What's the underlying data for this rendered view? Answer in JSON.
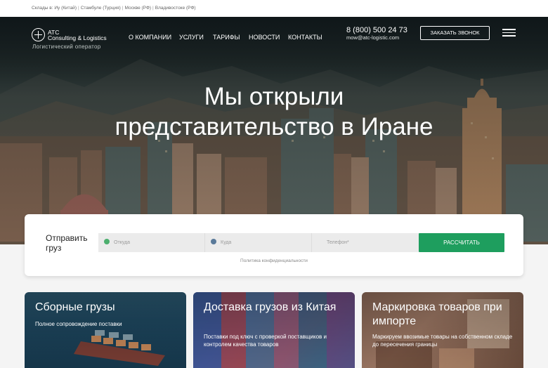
{
  "topbar": {
    "items": [
      "Склады в: Иу (Китай)",
      "Стамбуле (Турция)",
      "Москве (РФ)",
      "Владивостоке (РФ)"
    ],
    "separator": "|"
  },
  "logo": {
    "line1": "ATC",
    "line2": "Consulting & Logistics",
    "subtitle": "Логистический оператор"
  },
  "nav": {
    "items": [
      "О КОМПАНИИ",
      "УСЛУГИ",
      "ТАРИФЫ",
      "НОВОСТИ",
      "КОНТАКТЫ"
    ]
  },
  "contacts": {
    "phone": "8 (800) 500 24 73",
    "email": "mow@atc-logistic.com"
  },
  "header": {
    "call_button": "ЗАКАЗАТЬ ЗВОНОК",
    "menu_icon": "hamburger-menu-icon"
  },
  "hero": {
    "title_line1": "Мы открыли",
    "title_line2": "представительство в Иране"
  },
  "form": {
    "label": "Отправить груз",
    "from_placeholder": "Откуда",
    "to_placeholder": "Куда",
    "phone_placeholder": "Телефон*",
    "submit_label": "РАССЧИТАТЬ",
    "policy": "Политика конфиденциальности",
    "from_icon": "location-pin-icon",
    "to_icon": "location-pin-icon",
    "from_icon_color": "#4caf6e",
    "to_icon_color": "#5a7a9a"
  },
  "cards": [
    {
      "title": "Сборные грузы",
      "description": "Полное сопровождение поставки"
    },
    {
      "title": "Доставка грузов из Китая",
      "description": "Поставки под ключ с проверкой поставщиков и контролем качества товаров"
    },
    {
      "title": "Маркировка товаров при импорте",
      "description": "Маркируем ввозимые товары на собственном складе до пересечения границы"
    }
  ],
  "colors": {
    "accent_green": "#1e9e5e",
    "hero_dark": "#1b2528",
    "page_bg": "#f4f4f4"
  }
}
